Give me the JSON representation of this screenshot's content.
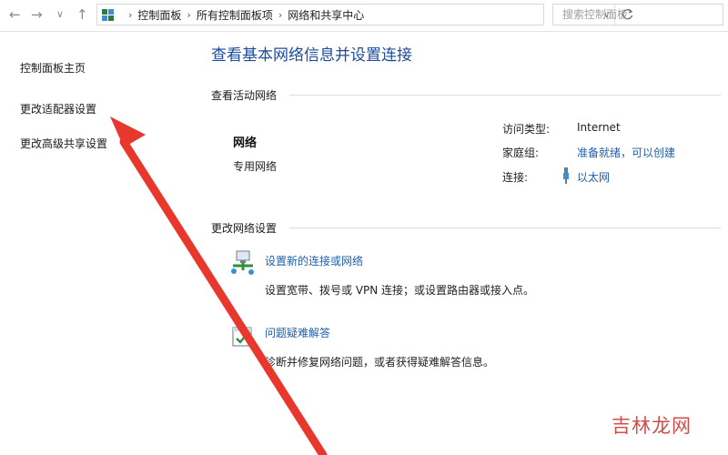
{
  "nav": {
    "back": "←",
    "forward": "→",
    "recent": "∨",
    "up": "↑"
  },
  "breadcrumb": [
    "控制面板",
    "所有控制面板项",
    "网络和共享中心"
  ],
  "search": {
    "placeholder": "搜索控制面板"
  },
  "sidebar": {
    "items": [
      {
        "label": "控制面板主页"
      },
      {
        "label": "更改适配器设置"
      },
      {
        "label": "更改高级共享设置"
      }
    ]
  },
  "main": {
    "title": "查看基本网络信息并设置连接",
    "active_section": "查看活动网络",
    "network": {
      "name": "网络",
      "type": "专用网络"
    },
    "info": {
      "access_label": "访问类型:",
      "access_value": "Internet",
      "homegroup_label": "家庭组:",
      "homegroup_value": "准备就绪，可以创建",
      "connection_label": "连接:",
      "connection_value": "以太网"
    },
    "change_section": "更改网络设置",
    "tasks": [
      {
        "link": "设置新的连接或网络",
        "desc": "设置宽带、拨号或 VPN 连接；或设置路由器或接入点。"
      },
      {
        "link": "问题疑难解答",
        "desc": "诊断并修复网络问题，或者获得疑难解答信息。"
      }
    ]
  },
  "watermark": "吉林龙网",
  "colors": {
    "title": "#1e4b9a",
    "link": "#1e5fae",
    "arrow": "#e8382e",
    "watermark": "#c9302c"
  }
}
